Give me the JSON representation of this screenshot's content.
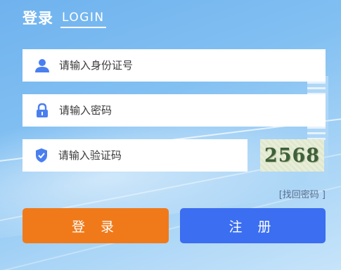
{
  "header": {
    "title_cn": "登录",
    "title_en": "LOGIN"
  },
  "form": {
    "id_placeholder": "请输入身份证号",
    "password_placeholder": "请输入密码",
    "captcha_placeholder": "请输入验证码",
    "captcha_code": "2568",
    "forgot_link": "[找回密码 ]"
  },
  "buttons": {
    "login": "登 录",
    "register": "注 册"
  },
  "colors": {
    "icon": "#4a7ff0",
    "login_button": "#f07a1a",
    "register_button": "#3b6ef0"
  },
  "icons": {
    "id": "user-icon",
    "password": "lock-icon",
    "captcha": "shield-icon"
  }
}
